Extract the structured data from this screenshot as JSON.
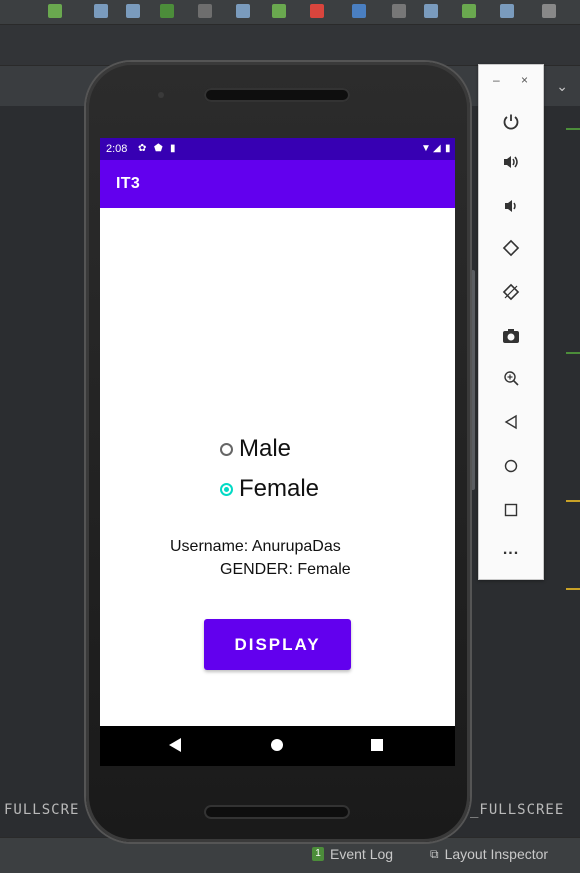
{
  "ide": {
    "status_bar": {
      "event_log_badge": "1",
      "event_log": "Event Log",
      "layout_inspector": "Layout Inspector"
    },
    "fullscreen_left": "FULLSCRE",
    "fullscreen_right": "_FULLSCREE"
  },
  "phone": {
    "status": {
      "time": "2:08"
    },
    "app": {
      "title": "IT3"
    },
    "radios": [
      {
        "label": "Male",
        "checked": false
      },
      {
        "label": "Female",
        "checked": true
      }
    ],
    "info": {
      "username": "Username: AnurupaDas",
      "gender": "GENDER: Female"
    },
    "button": {
      "label": "DISPLAY"
    }
  },
  "emulator_panel": {
    "window_controls": {
      "minimize": "–",
      "close": "×"
    },
    "buttons": [
      "power-icon",
      "volume-up-icon",
      "volume-down-icon",
      "rotate-left-icon",
      "rotate-right-icon",
      "camera-icon",
      "zoom-icon",
      "back-icon",
      "home-icon",
      "overview-icon",
      "more-icon"
    ],
    "more_label": "..."
  },
  "colors": {
    "primary": "#6200ee",
    "primary_dark": "#3700b3",
    "accent": "#03dac5"
  }
}
